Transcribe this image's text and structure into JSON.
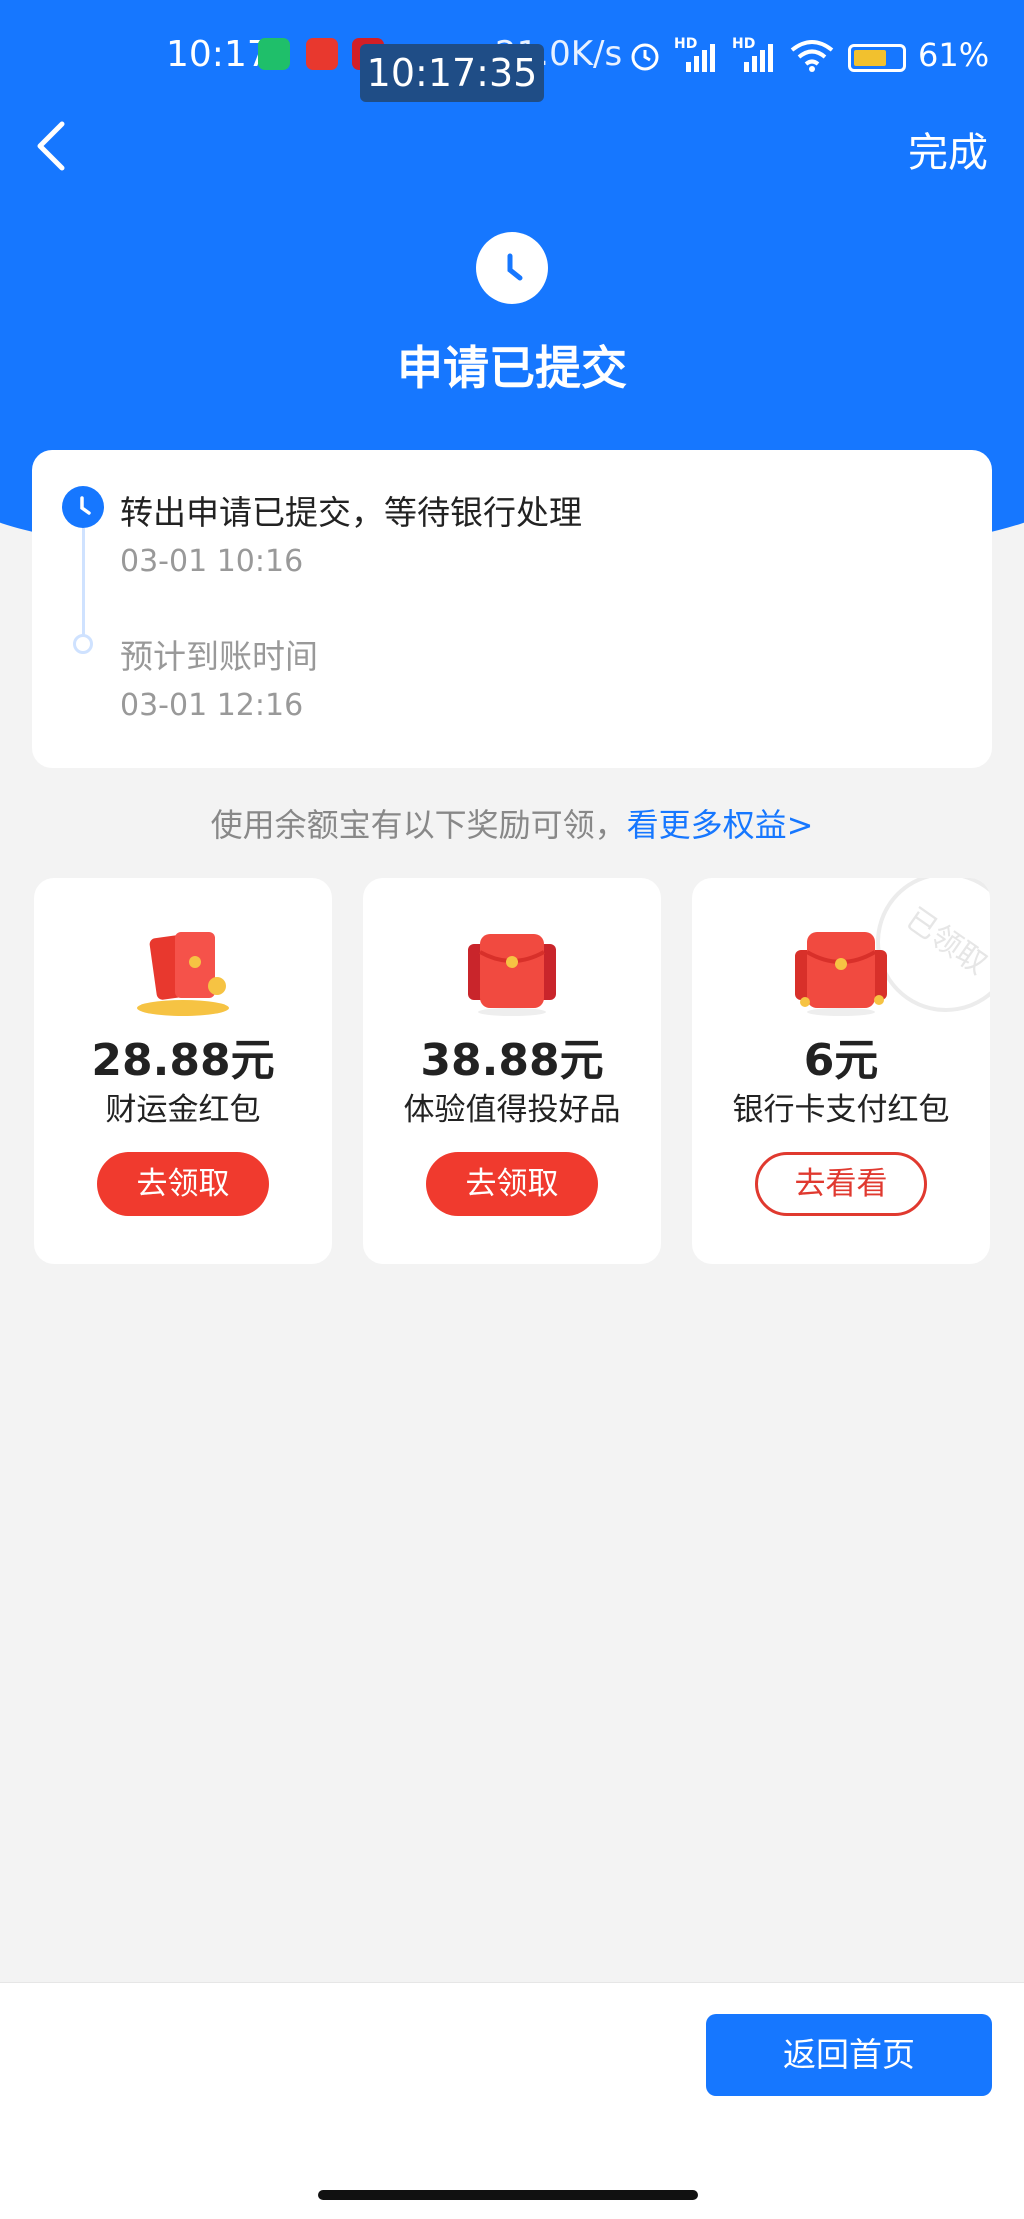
{
  "status_bar": {
    "time": "10:17",
    "overlay_clock": "10:17:35",
    "network_speed": "21.0K/s",
    "signal_1": "HD",
    "signal_2": "HD",
    "battery": "61%"
  },
  "nav": {
    "done_label": "完成"
  },
  "header": {
    "title": "申请已提交"
  },
  "progress": {
    "steps": [
      {
        "text": "转出申请已提交，等待银行处理",
        "time": "03-01 10:16"
      },
      {
        "text": "预计到账时间",
        "time": "03-01 12:16"
      }
    ]
  },
  "rewards": {
    "intro": "使用余额宝有以下奖励可领，",
    "link": "看更多权益>",
    "items": [
      {
        "amount": "28.88元",
        "name": "财运金红包",
        "button": "去领取"
      },
      {
        "amount": "38.88元",
        "name": "体验值得投好品",
        "button": "去领取"
      },
      {
        "amount": "6元",
        "name": "银行卡支付红包",
        "button": "去看看",
        "stamp": "已领取"
      }
    ]
  },
  "bottom": {
    "home_button": "返回首页"
  },
  "colors": {
    "primary_blue": "#1677ff",
    "red_button": "#f03a2e",
    "background": "#f3f3f3"
  }
}
